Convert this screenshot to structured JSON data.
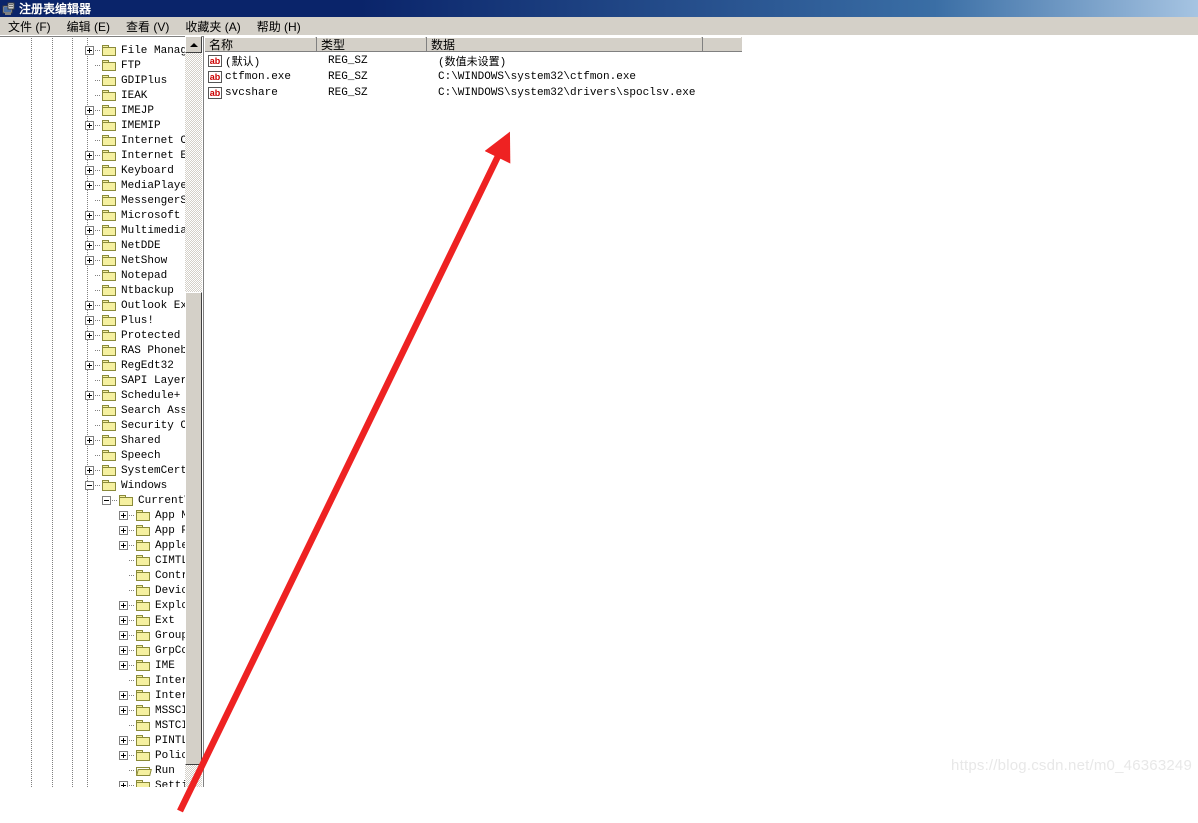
{
  "window": {
    "title": "注册表编辑器",
    "icon": "registry-editor-icon"
  },
  "menubar": {
    "items": [
      {
        "label": "文件 (F)"
      },
      {
        "label": "编辑 (E)"
      },
      {
        "label": "查看 (V)"
      },
      {
        "label": "收藏夹 (A)"
      },
      {
        "label": "帮助 (H)"
      }
    ]
  },
  "tree": {
    "scrollbar": {
      "up_arrow_icon": "scroll-up-arrow-icon"
    },
    "nodes": [
      {
        "label": "File Manager",
        "indent": 1,
        "expander": "plus",
        "icon": "folder-icon"
      },
      {
        "label": "FTP",
        "indent": 1,
        "expander": "none",
        "icon": "folder-icon"
      },
      {
        "label": "GDIPlus",
        "indent": 1,
        "expander": "none",
        "icon": "folder-icon"
      },
      {
        "label": "IEAK",
        "indent": 1,
        "expander": "none",
        "icon": "folder-icon"
      },
      {
        "label": "IMEJP",
        "indent": 1,
        "expander": "plus",
        "icon": "folder-icon"
      },
      {
        "label": "IMEMIP",
        "indent": 1,
        "expander": "plus",
        "icon": "folder-icon"
      },
      {
        "label": "Internet Conn",
        "indent": 1,
        "expander": "none",
        "icon": "folder-icon"
      },
      {
        "label": "Internet Expl",
        "indent": 1,
        "expander": "plus",
        "icon": "folder-icon"
      },
      {
        "label": "Keyboard",
        "indent": 1,
        "expander": "plus",
        "icon": "folder-icon"
      },
      {
        "label": "MediaPlayer",
        "indent": 1,
        "expander": "plus",
        "icon": "folder-icon"
      },
      {
        "label": "MessengerServ",
        "indent": 1,
        "expander": "none",
        "icon": "folder-icon"
      },
      {
        "label": "Microsoft Man",
        "indent": 1,
        "expander": "plus",
        "icon": "folder-icon"
      },
      {
        "label": "Multimedia",
        "indent": 1,
        "expander": "plus",
        "icon": "folder-icon"
      },
      {
        "label": "NetDDE",
        "indent": 1,
        "expander": "plus",
        "icon": "folder-icon"
      },
      {
        "label": "NetShow",
        "indent": 1,
        "expander": "plus",
        "icon": "folder-icon"
      },
      {
        "label": "Notepad",
        "indent": 1,
        "expander": "none",
        "icon": "folder-icon"
      },
      {
        "label": "Ntbackup",
        "indent": 1,
        "expander": "none",
        "icon": "folder-icon"
      },
      {
        "label": "Outlook Expre",
        "indent": 1,
        "expander": "plus",
        "icon": "folder-icon"
      },
      {
        "label": "Plus!",
        "indent": 1,
        "expander": "plus",
        "icon": "folder-icon"
      },
      {
        "label": "Protected Sto",
        "indent": 1,
        "expander": "plus",
        "icon": "folder-icon"
      },
      {
        "label": "RAS Phonebook",
        "indent": 1,
        "expander": "none",
        "icon": "folder-icon"
      },
      {
        "label": "RegEdt32",
        "indent": 1,
        "expander": "plus",
        "icon": "folder-icon"
      },
      {
        "label": "SAPI Layer",
        "indent": 1,
        "expander": "none",
        "icon": "folder-icon"
      },
      {
        "label": "Schedule+",
        "indent": 1,
        "expander": "plus",
        "icon": "folder-icon"
      },
      {
        "label": "Search Assist",
        "indent": 1,
        "expander": "none",
        "icon": "folder-icon"
      },
      {
        "label": "Security Cent",
        "indent": 1,
        "expander": "none",
        "icon": "folder-icon"
      },
      {
        "label": "Shared",
        "indent": 1,
        "expander": "plus",
        "icon": "folder-icon"
      },
      {
        "label": "Speech",
        "indent": 1,
        "expander": "none",
        "icon": "folder-icon"
      },
      {
        "label": "SystemCertifi",
        "indent": 1,
        "expander": "plus",
        "icon": "folder-icon"
      },
      {
        "label": "Windows",
        "indent": 1,
        "expander": "minus",
        "icon": "folder-icon"
      },
      {
        "label": "CurrentVer",
        "indent": 2,
        "expander": "minus",
        "icon": "folder-icon"
      },
      {
        "label": "App Man",
        "indent": 3,
        "expander": "plus",
        "icon": "folder-icon"
      },
      {
        "label": "App Pat",
        "indent": 3,
        "expander": "plus",
        "icon": "folder-icon"
      },
      {
        "label": "Applets",
        "indent": 3,
        "expander": "plus",
        "icon": "folder-icon"
      },
      {
        "label": "CIMTLGI",
        "indent": 3,
        "expander": "none",
        "icon": "folder-icon"
      },
      {
        "label": "Control",
        "indent": 3,
        "expander": "none",
        "icon": "folder-icon"
      },
      {
        "label": "Device",
        "indent": 3,
        "expander": "none",
        "icon": "folder-icon"
      },
      {
        "label": "Explore",
        "indent": 3,
        "expander": "plus",
        "icon": "folder-icon"
      },
      {
        "label": "Ext",
        "indent": 3,
        "expander": "plus",
        "icon": "folder-icon"
      },
      {
        "label": "Group P",
        "indent": 3,
        "expander": "plus",
        "icon": "folder-icon"
      },
      {
        "label": "GrpConv",
        "indent": 3,
        "expander": "plus",
        "icon": "folder-icon"
      },
      {
        "label": "IME",
        "indent": 3,
        "expander": "plus",
        "icon": "folder-icon"
      },
      {
        "label": "Interne",
        "indent": 3,
        "expander": "none",
        "icon": "folder-icon"
      },
      {
        "label": "Interne",
        "indent": 3,
        "expander": "plus",
        "icon": "folder-icon"
      },
      {
        "label": "MSSCIPY",
        "indent": 3,
        "expander": "plus",
        "icon": "folder-icon"
      },
      {
        "label": "MSTCIPH",
        "indent": 3,
        "expander": "none",
        "icon": "folder-icon"
      },
      {
        "label": "PINTLGH",
        "indent": 3,
        "expander": "plus",
        "icon": "folder-icon"
      },
      {
        "label": "Polici",
        "indent": 3,
        "expander": "plus",
        "icon": "folder-icon"
      },
      {
        "label": "Run",
        "indent": 3,
        "expander": "none",
        "icon": "folder-open-icon"
      },
      {
        "label": "Settins",
        "indent": 3,
        "expander": "plus",
        "icon": "folder-icon"
      }
    ]
  },
  "list": {
    "columns": [
      {
        "label": "名称"
      },
      {
        "label": "类型"
      },
      {
        "label": "数据"
      }
    ],
    "rows": [
      {
        "icon": "string-value-icon",
        "name": "(默认)",
        "type": "REG_SZ",
        "data": "(数值未设置)"
      },
      {
        "icon": "string-value-icon",
        "name": "ctfmon.exe",
        "type": "REG_SZ",
        "data": "C:\\WINDOWS\\system32\\ctfmon.exe"
      },
      {
        "icon": "string-value-icon",
        "name": "svcshare",
        "type": "REG_SZ",
        "data": "C:\\WINDOWS\\system32\\drivers\\spoclsv.exe"
      }
    ]
  },
  "annotation": {
    "arrow_icon": "red-arrow-annotation",
    "color": "#ee2222"
  },
  "watermark": {
    "text": "https://blog.csdn.net/m0_46363249"
  }
}
